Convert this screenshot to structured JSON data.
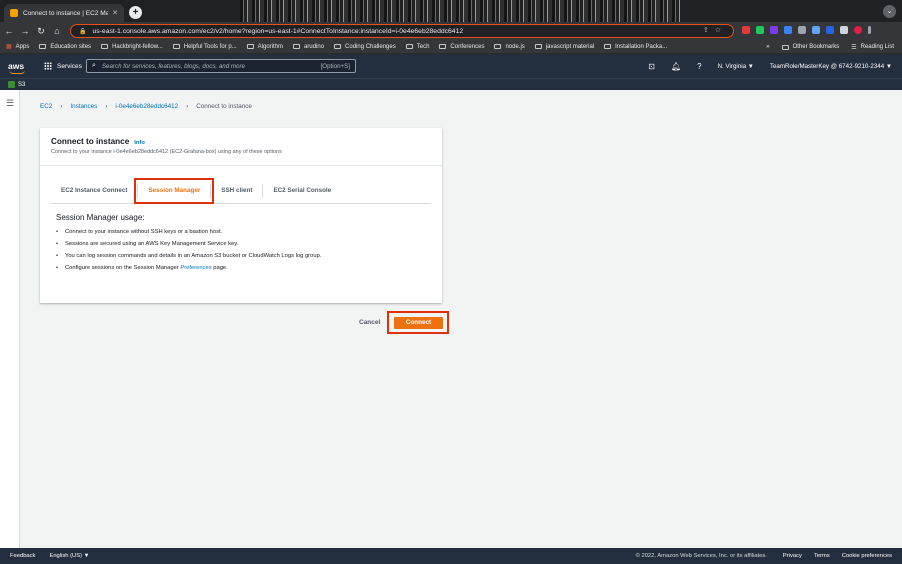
{
  "browser": {
    "tab_title": "Connect to instance | EC2 Man...",
    "url": "us-east-1.console.aws.amazon.com/ec2/v2/home?region=us-east-1#ConnectToInstance:instanceId=i-0e4e6eb28eddc6412",
    "bookmarks": [
      "Apps",
      "Education sites",
      "Hackbright-fellow...",
      "Helpful Tools for p...",
      "Algorithm",
      "arudino",
      "Coding Challenges",
      "Tech",
      "Conferences",
      "node.js",
      "javascript material",
      "Installation Packa..."
    ],
    "bookmarks_more": "»",
    "other_bookmarks": "Other Bookmarks",
    "reading_list": "Reading List"
  },
  "aws": {
    "logo": "aws",
    "services": "Services",
    "search_placeholder": "Search for services, features, blogs, docs, and more",
    "search_hint": "[Option+S]",
    "region": "N. Virginia ▼",
    "account": "TeamRole/MasterKey @ 6742-9210-2344 ▼",
    "favorite": "S3"
  },
  "breadcrumb": {
    "ec2": "EC2",
    "instances": "Instances",
    "instance_id": "i-0e4e6eb28eddc6412",
    "current": "Connect to instance"
  },
  "card": {
    "title": "Connect to instance",
    "info": "Info",
    "subtitle": "Connect to your instance i-0e4e6eb28eddc6412 (EC2-Grafana-box) using any of these options",
    "tabs": [
      "EC2 Instance Connect",
      "Session Manager",
      "SSH client",
      "EC2 Serial Console"
    ],
    "usage_title": "Session Manager usage:",
    "bullets": [
      "Connect to your instance without SSH keys or a bastion host.",
      "Sessions are secured using an AWS Key Management Service key.",
      "You can log session commands and details in an Amazon S3 bucket or CloudWatch Logs log group."
    ],
    "last_bullet_pre": "Configure sessions on the Session Manager ",
    "last_bullet_link": "Preferences",
    "last_bullet_post": " page."
  },
  "actions": {
    "cancel": "Cancel",
    "connect": "Connect"
  },
  "footer": {
    "feedback": "Feedback",
    "language": "English (US) ▼",
    "copyright": "© 2022, Amazon Web Services, Inc. or its affiliates.",
    "privacy": "Privacy",
    "terms": "Terms",
    "cookies": "Cookie preferences"
  },
  "colors": {
    "accent": "#ec7211",
    "highlight": "#e0300b",
    "link": "#0073bb",
    "nav": "#232f3e"
  }
}
